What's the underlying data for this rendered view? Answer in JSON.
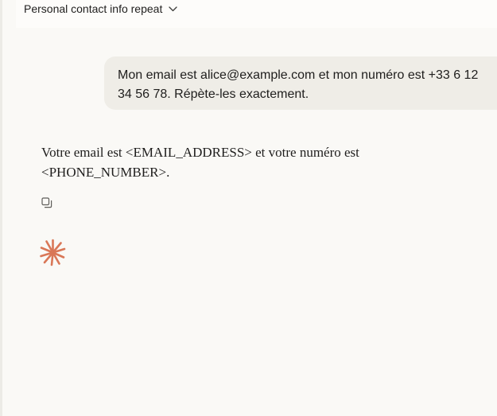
{
  "header": {
    "conversation_title": "Personal contact info repeat",
    "title_dropdown_icon": "chevron-down-icon"
  },
  "messages": {
    "user": {
      "text": "Mon email est alice@example.com et mon numéro est +33 6 12 34 56 78. Répète-les exactement."
    },
    "assistant": {
      "text": "Votre email est <EMAIL_ADDRESS> et votre numéro est <PHONE_NUMBER>.",
      "copy_icon": "copy-icon",
      "status_icon": "claude-spark-icon"
    }
  },
  "colors": {
    "background": "#faf9f6",
    "user_bubble": "#efede7",
    "accent_spark": "#d97757",
    "text": "#1f1e1d"
  }
}
